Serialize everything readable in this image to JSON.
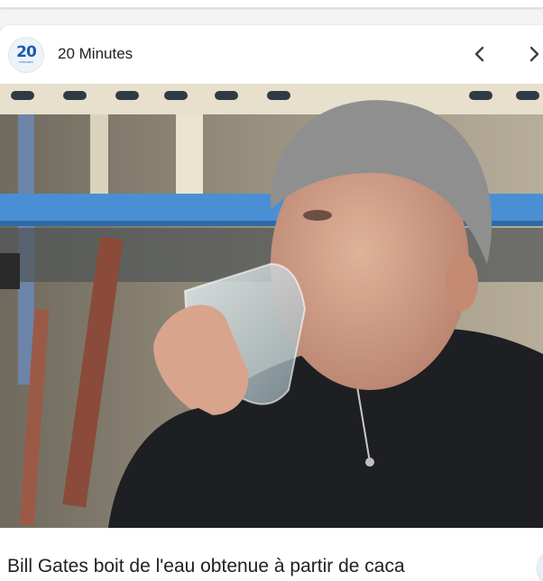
{
  "publisher": {
    "name": "20 Minutes",
    "logo_digits": "20",
    "logo_word": "minutes",
    "brand_color": "#1a5bb5"
  },
  "navigation": {
    "prev_icon": "chevron-left-icon",
    "next_icon": "chevron-right-icon"
  },
  "image": {
    "lens_icon": "google-lens-icon"
  },
  "headline": "Bill Gates boit de l'eau obtenue à partir de caca"
}
